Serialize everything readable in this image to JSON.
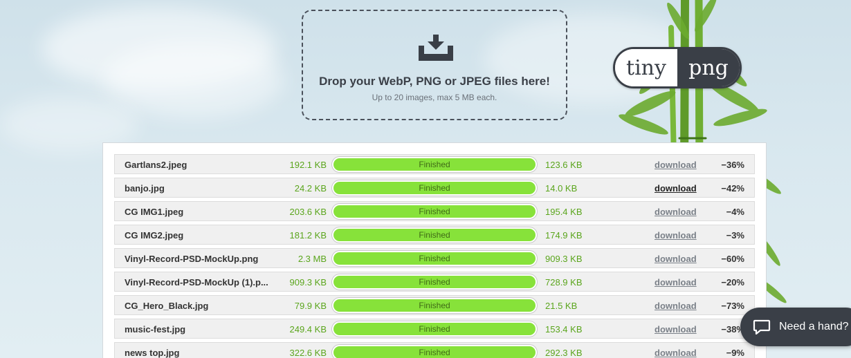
{
  "dropzone": {
    "icon": "download-tray-icon",
    "title": "Drop your WebP, PNG or JPEG files here!",
    "subtitle": "Up to 20 images, max 5 MB each."
  },
  "logo": {
    "left": "tiny",
    "right": "png"
  },
  "results": [
    {
      "name": "Gartlans2.jpeg",
      "original": "192.1 KB",
      "status": "Finished",
      "compressed": "123.6 KB",
      "action": "download",
      "saving": "−36%"
    },
    {
      "name": "banjo.jpg",
      "original": "24.2 KB",
      "status": "Finished",
      "compressed": "14.0 KB",
      "action": "download",
      "saving": "−42%"
    },
    {
      "name": "CG IMG1.jpeg",
      "original": "203.6 KB",
      "status": "Finished",
      "compressed": "195.4 KB",
      "action": "download",
      "saving": "−4%"
    },
    {
      "name": "CG IMG2.jpeg",
      "original": "181.2 KB",
      "status": "Finished",
      "compressed": "174.9 KB",
      "action": "download",
      "saving": "−3%"
    },
    {
      "name": "Vinyl-Record-PSD-MockUp.png",
      "original": "2.3 MB",
      "status": "Finished",
      "compressed": "909.3 KB",
      "action": "download",
      "saving": "−60%"
    },
    {
      "name": "Vinyl-Record-PSD-MockUp (1).p...",
      "original": "909.3 KB",
      "status": "Finished",
      "compressed": "728.9 KB",
      "action": "download",
      "saving": "−20%"
    },
    {
      "name": "CG_Hero_Black.jpg",
      "original": "79.9 KB",
      "status": "Finished",
      "compressed": "21.5 KB",
      "action": "download",
      "saving": "−73%"
    },
    {
      "name": "music-fest.jpg",
      "original": "249.4 KB",
      "status": "Finished",
      "compressed": "153.4 KB",
      "action": "download",
      "saving": "−38%"
    },
    {
      "name": "news top.jpg",
      "original": "322.6 KB",
      "status": "Finished",
      "compressed": "292.3 KB",
      "action": "download",
      "saving": "−9%"
    }
  ],
  "chat": {
    "label": "Need a hand?",
    "icon": "chat-bubble-icon"
  },
  "colors": {
    "accent": "#87e23a",
    "dark": "#3a3f47",
    "size_text": "#5aa51c"
  }
}
